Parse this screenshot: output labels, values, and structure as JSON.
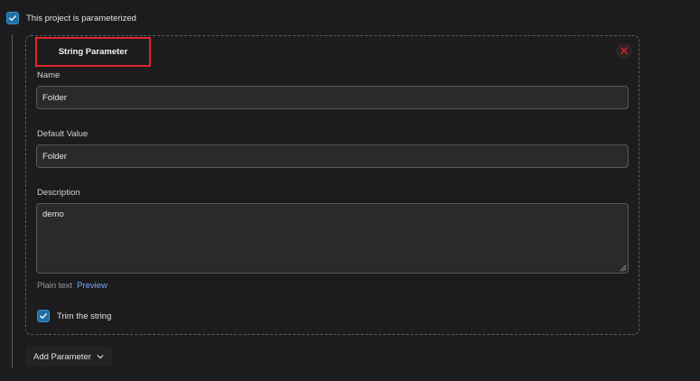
{
  "parameterized": {
    "label": "This project is parameterized",
    "checked": true
  },
  "parameter": {
    "type_title": "String Parameter",
    "name": {
      "label": "Name",
      "value": "Folder"
    },
    "default_value": {
      "label": "Default Value",
      "value": "Folder"
    },
    "description": {
      "label": "Description",
      "value": "demo"
    },
    "format": {
      "plain_text": "Plain text",
      "preview": "Preview"
    },
    "trim": {
      "label": "Trim the string",
      "checked": true
    }
  },
  "add_parameter": {
    "label": "Add Parameter"
  },
  "colors": {
    "accent": "#1f6fa6",
    "highlight_box": "#e0262a",
    "link": "#6ea8ff",
    "close_icon": "#e0262a"
  },
  "icons": {
    "check": "check-icon",
    "close": "close-icon",
    "dropdown": "chevron-down-icon",
    "resize": "resize-grip-icon"
  }
}
